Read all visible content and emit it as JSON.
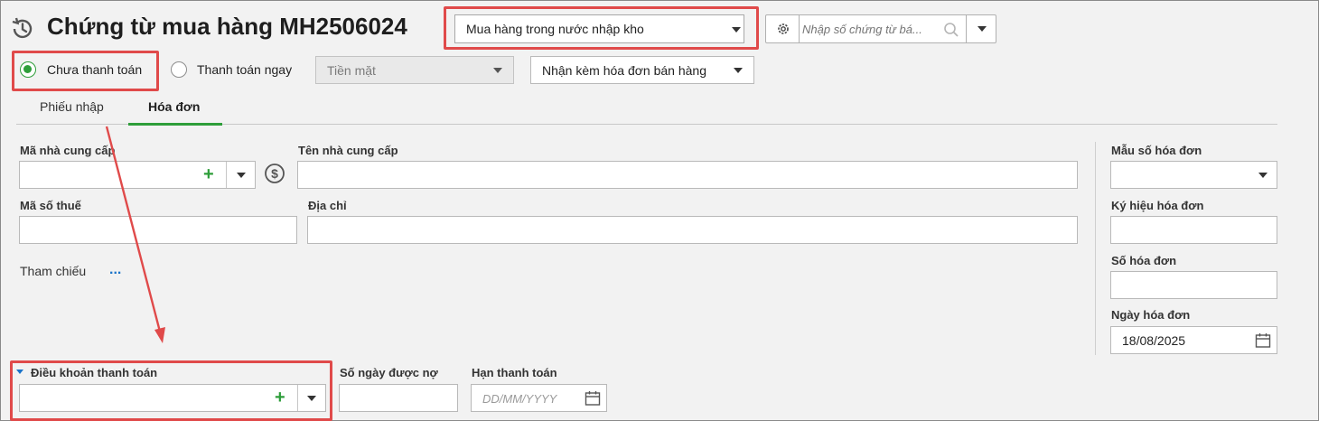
{
  "header": {
    "title": "Chứng từ mua hàng MH2506024",
    "purchase_type": "Mua hàng trong nước nhập kho",
    "search_placeholder": "Nhập số chứng từ bá..."
  },
  "payment": {
    "unpaid_label": "Chưa thanh toán",
    "pay_now_label": "Thanh toán ngay",
    "method_value": "Tiền mặt",
    "invoice_option": "Nhận kèm hóa đơn bán hàng"
  },
  "tabs": [
    {
      "label": "Phiếu nhập",
      "active": false
    },
    {
      "label": "Hóa đơn",
      "active": true
    }
  ],
  "form": {
    "supplier_code_label": "Mã nhà cung cấp",
    "supplier_name_label": "Tên nhà cung cấp",
    "tax_code_label": "Mã số thuế",
    "address_label": "Địa chỉ",
    "reference_label": "Tham chiếu",
    "reference_more": "...",
    "payment_terms_label": "Điều khoản thanh toán",
    "credit_days_label": "Số ngày được nợ",
    "due_date_label": "Hạn thanh toán",
    "due_date_placeholder": "DD/MM/YYYY"
  },
  "invoice": {
    "template_label": "Mẫu số hóa đơn",
    "symbol_label": "Ký hiệu hóa đơn",
    "number_label": "Số hóa đơn",
    "date_label": "Ngày hóa đơn",
    "date_value": "18/08/2025"
  },
  "colors": {
    "accent_green": "#2e9e3a",
    "highlight_red": "#e04a4a",
    "link_blue": "#1a73c9"
  }
}
